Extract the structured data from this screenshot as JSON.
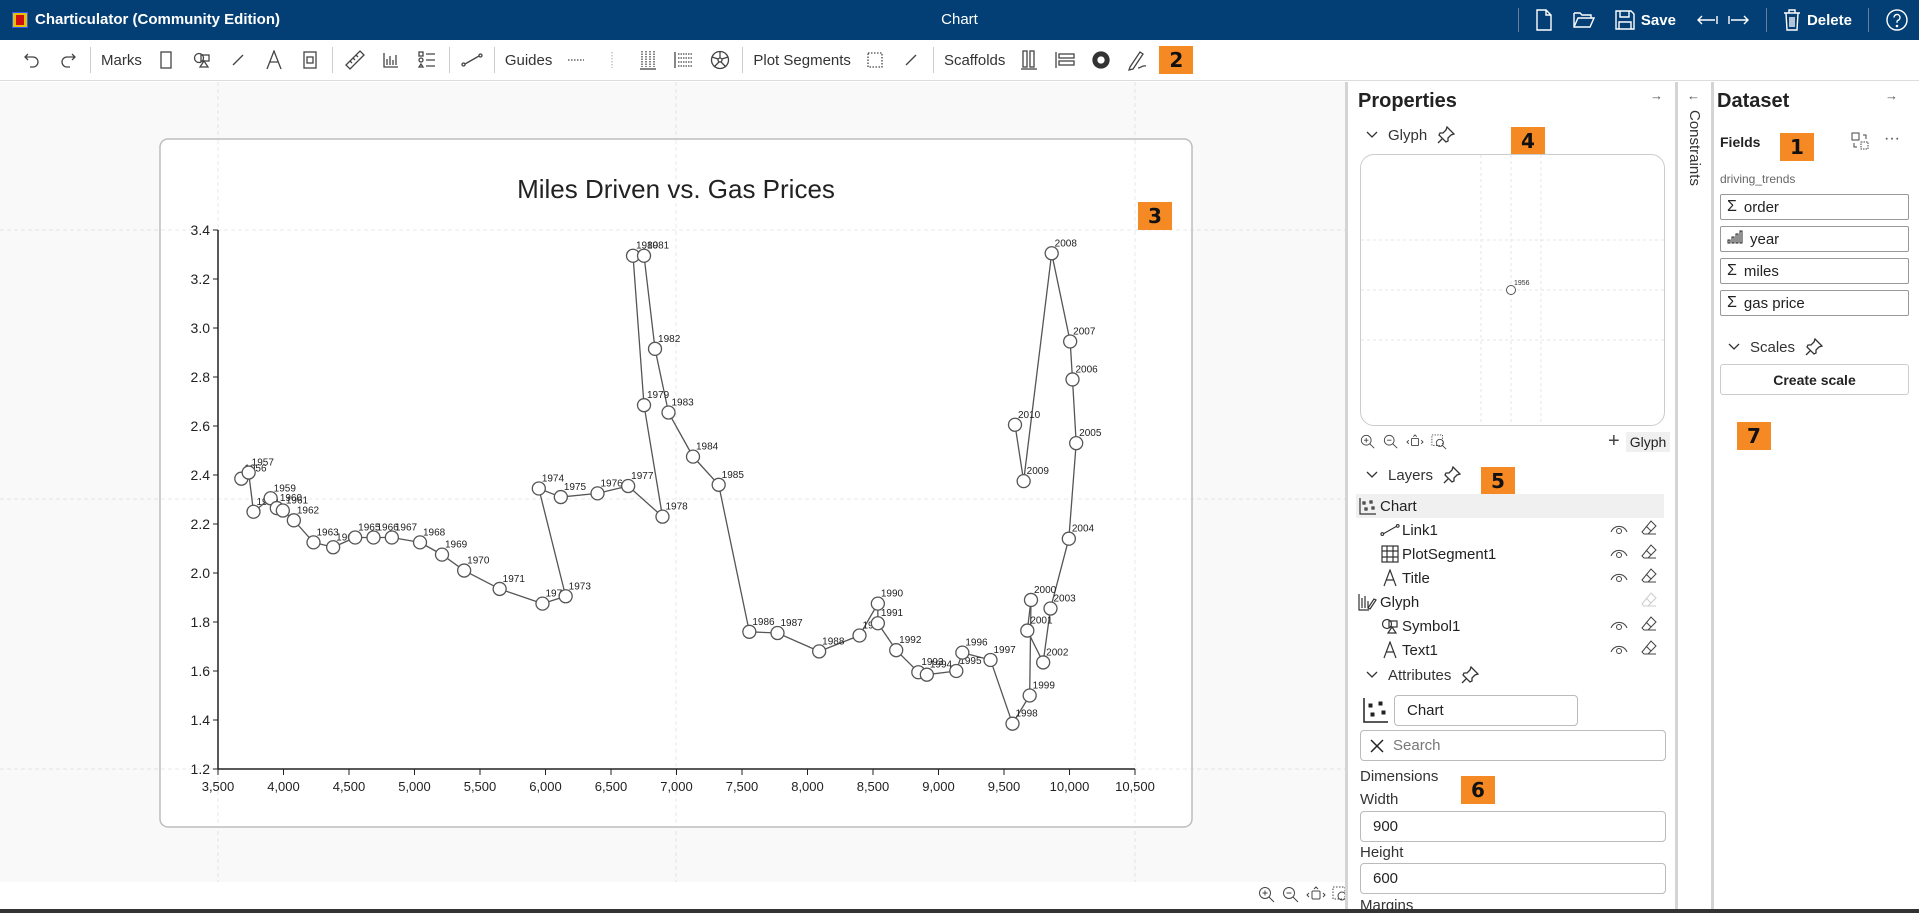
{
  "app": {
    "name": "Charticulator (Community Edition)",
    "document_title": "Chart",
    "actions": {
      "new": "new-file",
      "open": "open-folder",
      "save": "Save",
      "export_left": "←|",
      "export_right": "|→",
      "delete": "Delete",
      "help": "?"
    }
  },
  "toolbar": {
    "marks_label": "Marks",
    "guides_label": "Guides",
    "plot_segments_label": "Plot Segments",
    "scaffolds_label": "Scaffolds",
    "badge": "2"
  },
  "canvas": {
    "badge": "3"
  },
  "properties": {
    "title": "Properties",
    "glyph_section": "Glyph",
    "badge_glyph": "4",
    "glyph_preview_label": "1956",
    "add_glyph_label": "Glyph",
    "layers_section": "Layers",
    "badge_layers": "5",
    "layers": [
      {
        "name": "Chart",
        "icon": "chart-icon",
        "level": 0
      },
      {
        "name": "Link1",
        "icon": "link-icon",
        "level": 1
      },
      {
        "name": "PlotSegment1",
        "icon": "grid-icon",
        "level": 1
      },
      {
        "name": "Title",
        "icon": "text-icon",
        "level": 1
      },
      {
        "name": "Glyph",
        "icon": "glyph-icon",
        "level": 0
      },
      {
        "name": "Symbol1",
        "icon": "symbol-icon",
        "level": 1
      },
      {
        "name": "Text1",
        "icon": "text-icon",
        "level": 1
      }
    ],
    "attributes_section": "Attributes",
    "attributes_object": "Chart",
    "search_placeholder": "Search",
    "dimensions_label": "Dimensions",
    "badge_dimensions": "6",
    "width_label": "Width",
    "width_value": "900",
    "height_label": "Height",
    "height_value": "600",
    "margins_label": "Margins"
  },
  "constraints": {
    "label": "Constraints"
  },
  "dataset": {
    "title": "Dataset",
    "fields_label": "Fields",
    "badge_fields": "1",
    "table_name": "driving_trends",
    "fields": [
      {
        "name": "order",
        "type": "numeric"
      },
      {
        "name": "year",
        "type": "ordinal"
      },
      {
        "name": "miles",
        "type": "numeric"
      },
      {
        "name": "gas price",
        "type": "numeric"
      }
    ],
    "scales_section": "Scales",
    "create_scale": "Create scale",
    "badge_scales": "7"
  },
  "chart_data": {
    "type": "scatter",
    "title": "Miles Driven vs. Gas Prices",
    "xlabel": "",
    "ylabel": "",
    "xlim": [
      3500,
      10500
    ],
    "ylim": [
      1.2,
      3.4
    ],
    "xticks": [
      "3,500",
      "4,000",
      "4,500",
      "5,000",
      "5,500",
      "6,000",
      "6,500",
      "7,000",
      "7,500",
      "8,000",
      "8,500",
      "9,000",
      "9,500",
      "10,000",
      "10,500"
    ],
    "yticks": [
      "1.2",
      "1.4",
      "1.6",
      "1.8",
      "2.0",
      "2.2",
      "2.4",
      "2.6",
      "2.8",
      "3.0",
      "3.2",
      "3.4"
    ],
    "connected": true,
    "points": [
      {
        "year": "1956",
        "miles": 3678,
        "gas": 2.385
      },
      {
        "year": "1957",
        "miles": 3734,
        "gas": 2.41
      },
      {
        "year": "1958",
        "miles": 3771,
        "gas": 2.25
      },
      {
        "year": "1959",
        "miles": 3902,
        "gas": 2.305
      },
      {
        "year": "1960",
        "miles": 3949,
        "gas": 2.265
      },
      {
        "year": "1961",
        "miles": 3995,
        "gas": 2.255
      },
      {
        "year": "1962",
        "miles": 4079,
        "gas": 2.215
      },
      {
        "year": "1963",
        "miles": 4229,
        "gas": 2.125
      },
      {
        "year": "1964",
        "miles": 4379,
        "gas": 2.105
      },
      {
        "year": "1965",
        "miles": 4547,
        "gas": 2.145
      },
      {
        "year": "1966",
        "miles": 4687,
        "gas": 2.145
      },
      {
        "year": "1967",
        "miles": 4827,
        "gas": 2.145
      },
      {
        "year": "1968",
        "miles": 5042,
        "gas": 2.125
      },
      {
        "year": "1969",
        "miles": 5210,
        "gas": 2.075
      },
      {
        "year": "1970",
        "miles": 5379,
        "gas": 2.01
      },
      {
        "year": "1971",
        "miles": 5650,
        "gas": 1.935
      },
      {
        "year": "1972",
        "miles": 5977,
        "gas": 1.875
      },
      {
        "year": "1973",
        "miles": 6154,
        "gas": 1.905
      },
      {
        "year": "1974",
        "miles": 5949,
        "gas": 2.345
      },
      {
        "year": "1975",
        "miles": 6117,
        "gas": 2.31
      },
      {
        "year": "1976",
        "miles": 6397,
        "gas": 2.325
      },
      {
        "year": "1977",
        "miles": 6631,
        "gas": 2.355
      },
      {
        "year": "1978",
        "miles": 6893,
        "gas": 2.23
      },
      {
        "year": "1979",
        "miles": 6752,
        "gas": 2.685
      },
      {
        "year": "1980",
        "miles": 6668,
        "gas": 3.295
      },
      {
        "year": "1981",
        "miles": 6752,
        "gas": 3.295
      },
      {
        "year": "1982",
        "miles": 6836,
        "gas": 2.915
      },
      {
        "year": "1983",
        "miles": 6939,
        "gas": 2.655
      },
      {
        "year": "1984",
        "miles": 7126,
        "gas": 2.475
      },
      {
        "year": "1985",
        "miles": 7322,
        "gas": 2.36
      },
      {
        "year": "1986",
        "miles": 7556,
        "gas": 1.76
      },
      {
        "year": "1987",
        "miles": 7771,
        "gas": 1.755
      },
      {
        "year": "1988",
        "miles": 8089,
        "gas": 1.68
      },
      {
        "year": "1989",
        "miles": 8397,
        "gas": 1.745
      },
      {
        "year": "1990",
        "miles": 8537,
        "gas": 1.875
      },
      {
        "year": "1991",
        "miles": 8537,
        "gas": 1.795
      },
      {
        "year": "1992",
        "miles": 8677,
        "gas": 1.685
      },
      {
        "year": "1993",
        "miles": 8846,
        "gas": 1.595
      },
      {
        "year": "1994",
        "miles": 8911,
        "gas": 1.585
      },
      {
        "year": "1995",
        "miles": 9136,
        "gas": 1.6
      },
      {
        "year": "1996",
        "miles": 9182,
        "gas": 1.675
      },
      {
        "year": "1997",
        "miles": 9397,
        "gas": 1.645
      },
      {
        "year": "1998",
        "miles": 9565,
        "gas": 1.385
      },
      {
        "year": "1999",
        "miles": 9696,
        "gas": 1.5
      },
      {
        "year": "2000",
        "miles": 9706,
        "gas": 1.89
      },
      {
        "year": "2001",
        "miles": 9678,
        "gas": 1.765
      },
      {
        "year": "2002",
        "miles": 9799,
        "gas": 1.635
      },
      {
        "year": "2003",
        "miles": 9855,
        "gas": 1.855
      },
      {
        "year": "2004",
        "miles": 9995,
        "gas": 2.14
      },
      {
        "year": "2005",
        "miles": 10051,
        "gas": 2.53
      },
      {
        "year": "2006",
        "miles": 10023,
        "gas": 2.79
      },
      {
        "year": "2007",
        "miles": 10005,
        "gas": 2.945
      },
      {
        "year": "2008",
        "miles": 9864,
        "gas": 3.305
      },
      {
        "year": "2009",
        "miles": 9650,
        "gas": 2.375
      },
      {
        "year": "2010",
        "miles": 9584,
        "gas": 2.605
      }
    ]
  }
}
